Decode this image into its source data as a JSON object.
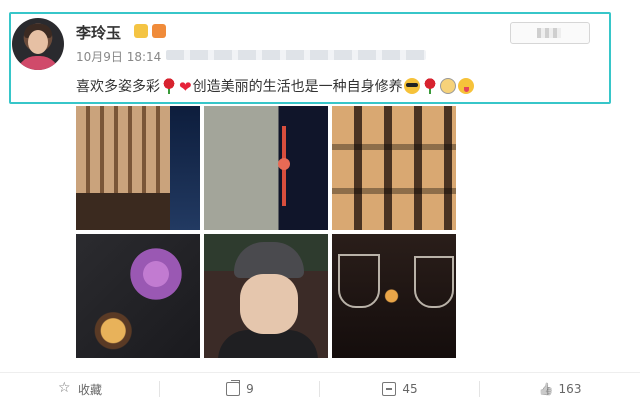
{
  "post": {
    "username": "李玲玉",
    "date": "10月9日 18:14",
    "text_part1": "喜欢多姿多彩",
    "text_part2": "创造美丽的生活也是一种自身修养",
    "heart_glyph": "❤"
  },
  "actions": {
    "favorite_label": "收藏",
    "share_count": "9",
    "comment_count": "45",
    "like_count": "163"
  },
  "colors": {
    "highlight_border": "#37c6c9",
    "text": "#333333",
    "meta": "#888888"
  },
  "icons": {
    "favorite": "star-icon",
    "share": "share-icon",
    "comment": "comment-icon",
    "like": "thumbs-up-icon"
  }
}
